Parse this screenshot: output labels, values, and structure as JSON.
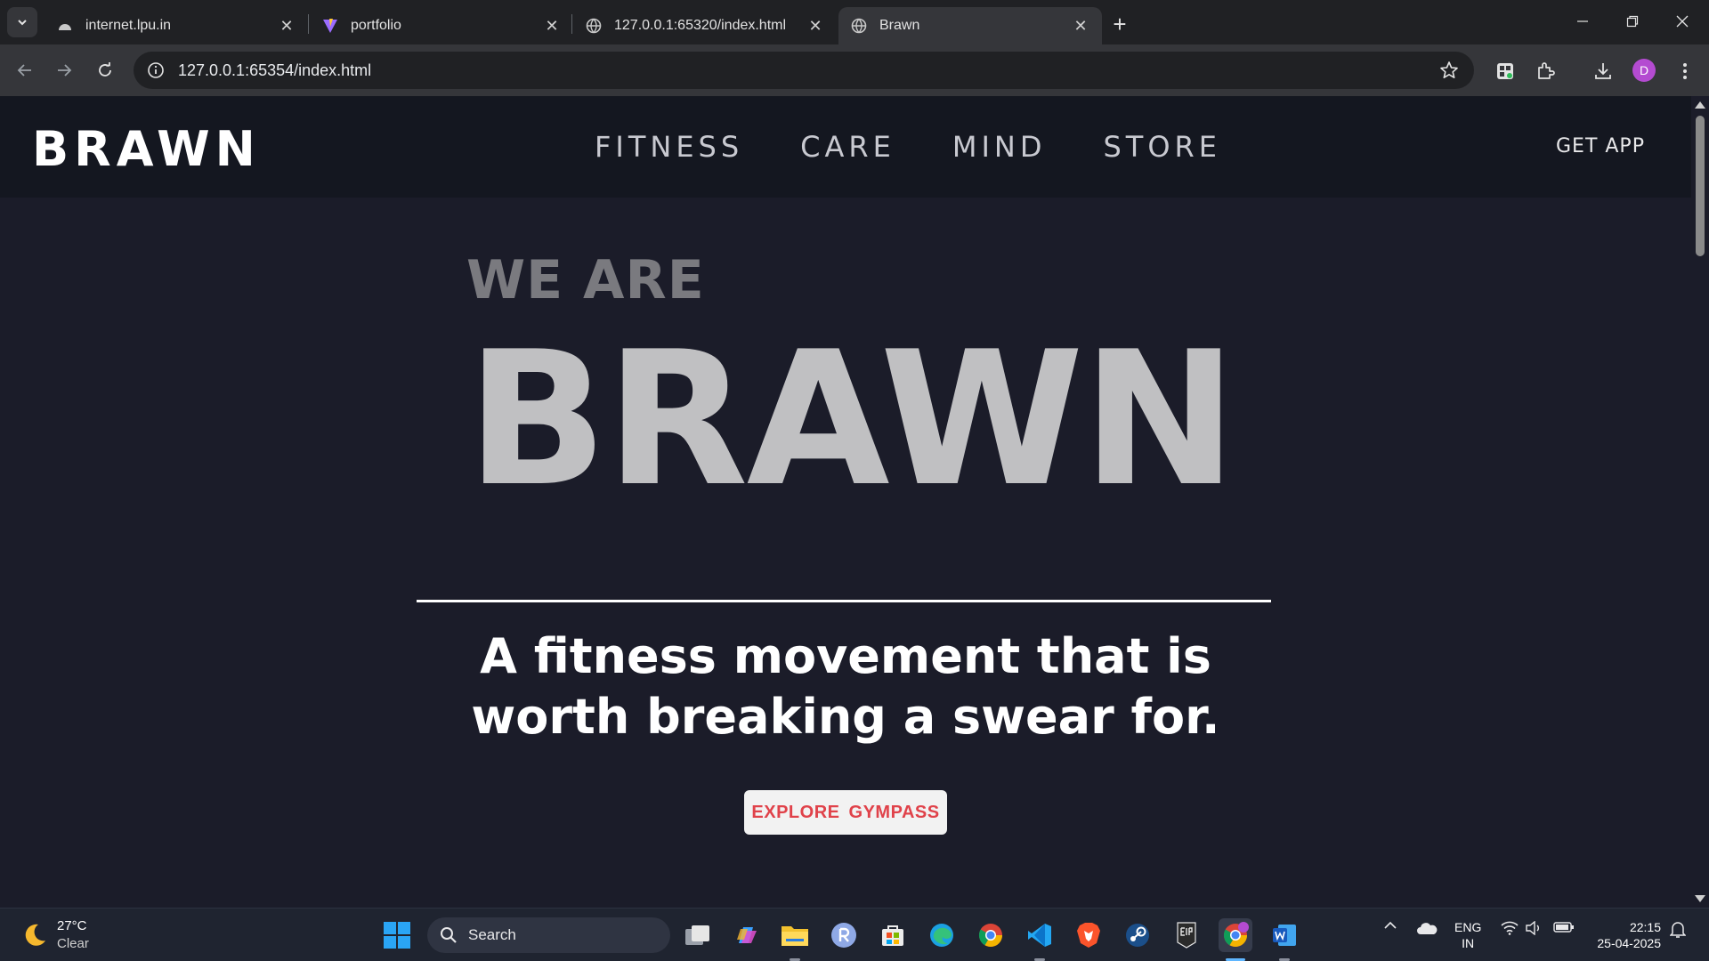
{
  "browser": {
    "tabs": [
      {
        "title": "internet.lpu.in",
        "icon": "cloud-icon",
        "active": false
      },
      {
        "title": "portfolio",
        "icon": "vite-icon",
        "active": false
      },
      {
        "title": "127.0.0.1:65320/index.html",
        "icon": "globe-icon",
        "active": false
      },
      {
        "title": "Brawn",
        "icon": "globe-icon",
        "active": true
      }
    ],
    "close_glyph": "✕",
    "new_tab_glyph": "+",
    "url": "127.0.0.1:65354/index.html",
    "profile_initial": "D"
  },
  "site": {
    "logo": "BRAWN",
    "nav": [
      "FITNESS",
      "CARE",
      "MIND",
      "STORE"
    ],
    "get_app": "GET APP",
    "hero": {
      "pre_title": "WE ARE",
      "title": "BRAWN",
      "tagline": "A fitness movement that is worth breaking a swear for.",
      "cta": "EXPLORE  GYMPASS"
    },
    "colors": {
      "header_bg": "#141720",
      "page_bg": "#1b1c29",
      "hero_title": "#c0c0c2",
      "cta_text": "#e0424a"
    }
  },
  "taskbar": {
    "weather": {
      "temp": "27°C",
      "condition": "Clear"
    },
    "search_label": "Search",
    "language": {
      "line1": "ENG",
      "line2": "IN"
    },
    "clock": {
      "time": "22:15",
      "date": "25-04-2025"
    }
  }
}
